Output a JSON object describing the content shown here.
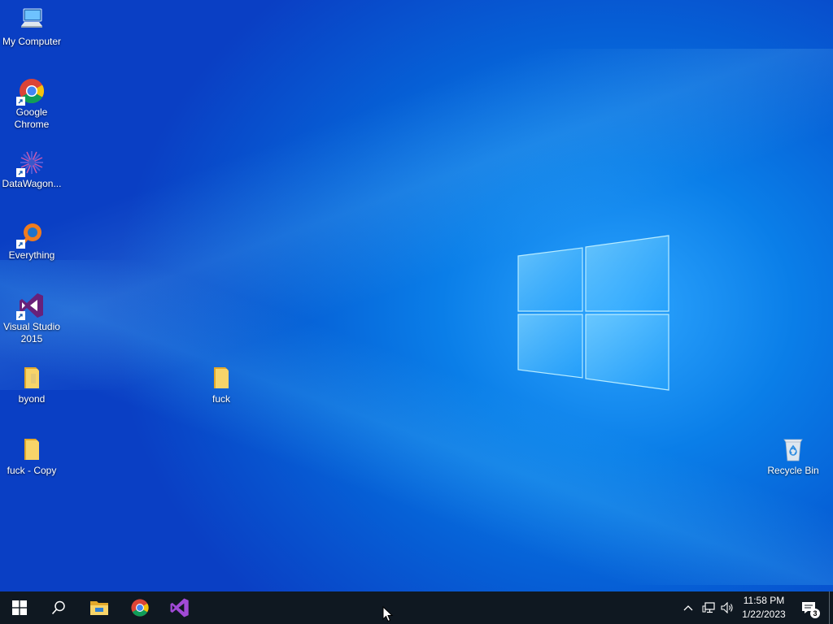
{
  "desktop": {
    "icons": [
      {
        "label": "My Computer",
        "icon": "computer-icon"
      },
      {
        "label": "Google Chrome",
        "icon": "chrome-icon"
      },
      {
        "label": "DataWagon...",
        "icon": "datawagon-icon"
      },
      {
        "label": "Everything",
        "icon": "everything-search-icon"
      },
      {
        "label": "Visual Studio 2015",
        "icon": "visual-studio-icon"
      },
      {
        "label": "byond",
        "icon": "folder-icon"
      },
      {
        "label": "fuck",
        "icon": "folder-icon"
      },
      {
        "label": "fuck - Copy",
        "icon": "folder-icon"
      },
      {
        "label": "Recycle Bin",
        "icon": "recycle-bin-icon"
      }
    ]
  },
  "taskbar": {
    "pinned": [
      {
        "icon": "windows-start-icon"
      },
      {
        "icon": "search-icon"
      },
      {
        "icon": "file-explorer-icon"
      },
      {
        "icon": "chrome-icon"
      },
      {
        "icon": "visual-studio-icon"
      }
    ],
    "tray": {
      "time": "11:58 PM",
      "date": "1/22/2023",
      "notification_count": "3"
    }
  },
  "colors": {
    "taskbar_bg": "#0f1821",
    "desktop_accent": "#0a7ee8",
    "folder_yellow": "#f4c542",
    "vs_purple": "#68217a"
  }
}
